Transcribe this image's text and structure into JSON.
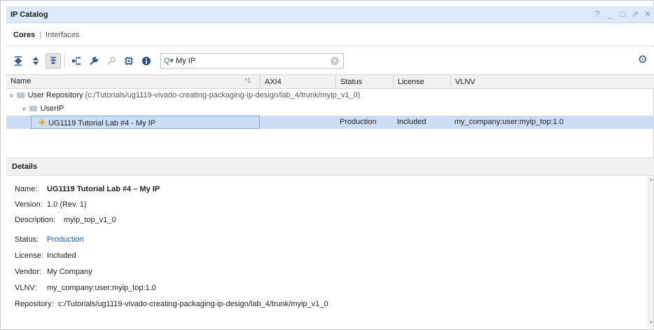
{
  "window": {
    "title": "IP Catalog",
    "controls": [
      "?",
      "_",
      "□",
      "⇗",
      "✕"
    ]
  },
  "subtabs": {
    "active": "Cores",
    "separator": "|",
    "other": "Interfaces"
  },
  "toolbar": {
    "icons": [
      "collapse-all-icon",
      "expand-all-icon",
      "group-icon",
      "hierarchy-icon",
      "wrench-icon",
      "key-icon",
      "chip-icon",
      "info-icon",
      "settings-icon"
    ],
    "search_value": "My IP"
  },
  "table": {
    "headers": {
      "name": "Name",
      "sort_indicator": "^1",
      "axi4": "AXI4",
      "status": "Status",
      "license": "License",
      "vlnv": "VLNV"
    },
    "repository": {
      "label": "User Repository",
      "path": "(c:/Tutorials/ug1119-vivado-creating-packaging-ip-design/lab_4/trunk/myip_v1_0)"
    },
    "group": {
      "label": "UserIP"
    },
    "ip_row": {
      "name": "UG1119 Tutorial Lab #4 - My IP",
      "axi4": "",
      "status": "Production",
      "license": "Included",
      "vlnv": "my_company:user:myip_top:1.0"
    }
  },
  "details": {
    "header": "Details",
    "name": {
      "label": "Name:",
      "value": "UG1119 Tutorial Lab #4 – My IP"
    },
    "version": {
      "label": "Version:",
      "value": "1.0 (Rev. 1)"
    },
    "description": {
      "label": "Description:",
      "value": "myip_top_v1_0"
    },
    "status": {
      "label": "Status:",
      "value": "Production"
    },
    "license": {
      "label": "License:",
      "value": "Included"
    },
    "vendor": {
      "label": "Vendor:",
      "value": "My Company"
    },
    "vlnv": {
      "label": "VLNV:",
      "value": "my_company:user:myip_top:1.0"
    },
    "repository": {
      "label": "Repository:",
      "value": "c:/Tutorials/ug1119-vivado-creating-packaging-ip-design/lab_4/trunk/myip_v1_0"
    }
  },
  "colors": {
    "title_bar": "#dbe9f8",
    "selection": "#ccddf6",
    "link": "#1f5fb5"
  }
}
